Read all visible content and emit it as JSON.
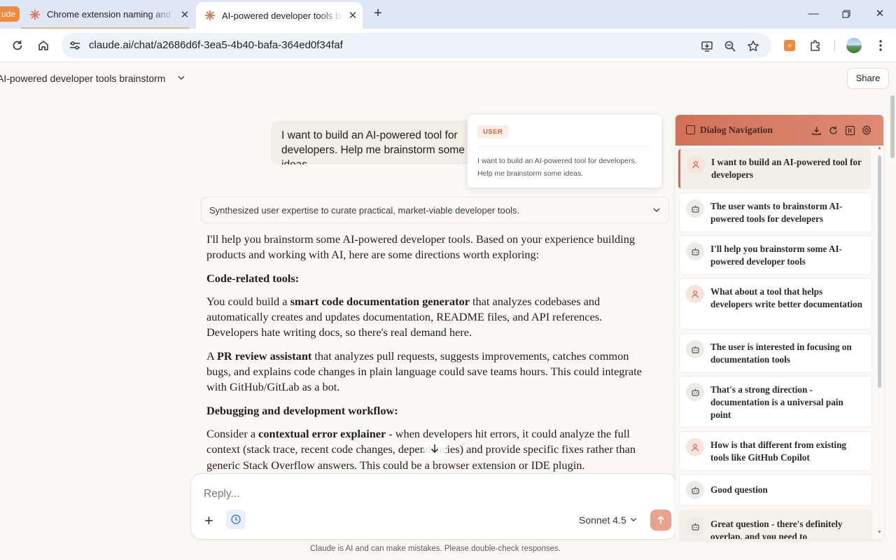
{
  "browser": {
    "tab_stub_label": "ude",
    "tabs": [
      {
        "title": "Chrome extension naming and"
      },
      {
        "title": "AI-powered developer tools bra"
      }
    ],
    "url": "claude.ai/chat/a2686d6f-3ea5-4b40-bafa-364ed0f34faf"
  },
  "chat": {
    "title": "AI-powered developer tools brainstorm",
    "share_label": "Share",
    "user_message": "I want to build an AI-powered tool for developers. Help me brainstorm some ideas.",
    "thinking_summary": "Synthesized user expertise to curate practical, market-viable developer tools.",
    "response": {
      "intro": "I'll help you brainstorm some AI-powered developer tools. Based on your experience building products and working with AI, here are some directions worth exploring:",
      "h1": "Code-related tools:",
      "p1_pre": "You could build a ",
      "p1_bold": "smart code documentation generator",
      "p1_post": " that analyzes codebases and automatically creates and updates documentation, README files, and API references. Developers hate writing docs, so there's real demand here.",
      "p2_pre": "A ",
      "p2_bold": "PR review assistant",
      "p2_post": " that analyzes pull requests, suggests improvements, catches common bugs, and explains code changes in plain language could save teams hours. This could integrate with GitHub/GitLab as a bot.",
      "h2": "Debugging and development workflow:",
      "p3_pre": "Consider a ",
      "p3_bold": "contextual error explainer",
      "p3_post": " - when developers hit errors, it could analyze the full context (stack trace, recent code changes, dependencies) and provide specific fixes rather than generic Stack Overflow answers. This could be a browser extension or IDE plugin."
    }
  },
  "tooltip": {
    "role": "USER",
    "text": "I want to build an AI-powered tool for developers. Help me brainstorm some ideas."
  },
  "composer": {
    "placeholder": "Reply...",
    "model": "Sonnet 4.5",
    "disclaimer": "Claude is AI and can make mistakes. Please double-check responses."
  },
  "dialog_nav": {
    "title": "Dialog Navigation",
    "items": [
      {
        "role": "user",
        "text": "I want to build an AI-powered tool for developers"
      },
      {
        "role": "assistant",
        "text": "The user wants to brainstorm AI-powered tools for developers"
      },
      {
        "role": "assistant",
        "text": "I'll help you brainstorm some AI-powered developer tools"
      },
      {
        "role": "user",
        "text": "What about a tool that helps developers write better documentation"
      },
      {
        "role": "assistant",
        "text": "The user is interested in focusing on documentation tools"
      },
      {
        "role": "assistant",
        "text": "That's a strong direction - documentation is a universal pain point"
      },
      {
        "role": "user",
        "text": "How is that different from existing tools like GitHub Copilot"
      },
      {
        "role": "assistant",
        "text": "Good question"
      },
      {
        "role": "assistant",
        "text": "Great question - there's definitely overlap, and you need to"
      }
    ]
  },
  "colors": {
    "accent": "#d97757",
    "panel_header": "#d27258",
    "send_button": "#e9a38c"
  }
}
